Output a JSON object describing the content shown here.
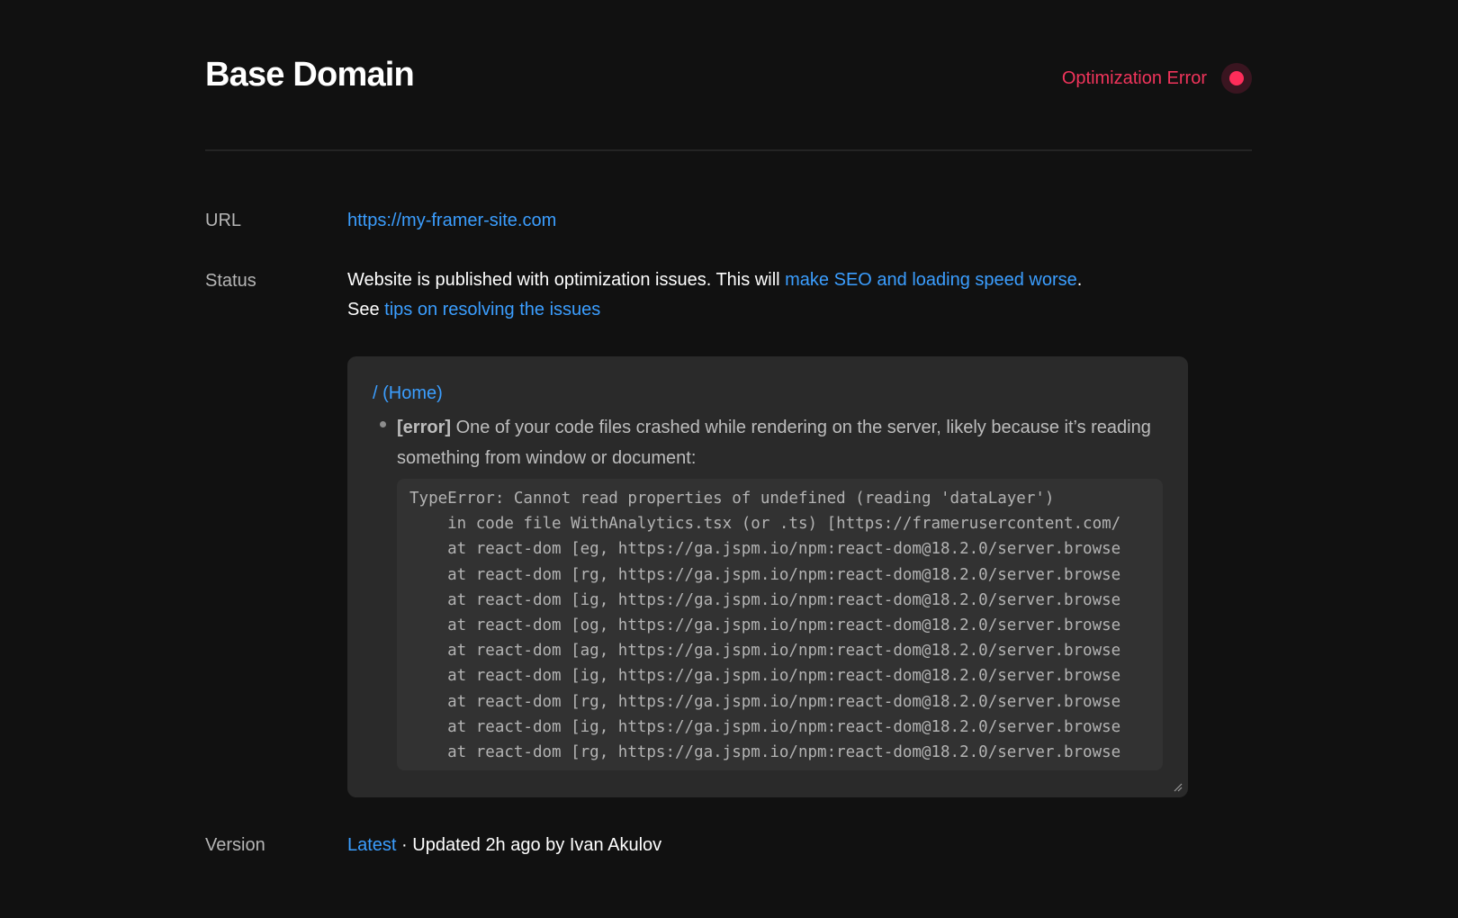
{
  "header": {
    "title": "Base Domain",
    "status_text": "Optimization Error",
    "status_color": "#f0345b"
  },
  "url_row": {
    "label": "URL",
    "value": "https://my-framer-site.com"
  },
  "status_row": {
    "label": "Status",
    "text_before": "Website is published with optimization issues. This will ",
    "link_1": "make SEO and loading speed worse",
    "text_after_link_1": ".",
    "text_see": "See ",
    "link_2": "tips on resolving the issues"
  },
  "error_box": {
    "route": "/ (Home)",
    "error_tag": "[error]",
    "error_message": " One of your code files crashed while rendering on the server, likely because it’s reading something from window or document:",
    "code_lines": [
      "TypeError: Cannot read properties of undefined (reading 'dataLayer')",
      "    in code file WithAnalytics.tsx (or .ts) [https://framerusercontent.com/",
      "    at react-dom [eg, https://ga.jspm.io/npm:react-dom@18.2.0/server.browse",
      "    at react-dom [rg, https://ga.jspm.io/npm:react-dom@18.2.0/server.browse",
      "    at react-dom [ig, https://ga.jspm.io/npm:react-dom@18.2.0/server.browse",
      "    at react-dom [og, https://ga.jspm.io/npm:react-dom@18.2.0/server.browse",
      "    at react-dom [ag, https://ga.jspm.io/npm:react-dom@18.2.0/server.browse",
      "    at react-dom [ig, https://ga.jspm.io/npm:react-dom@18.2.0/server.browse",
      "    at react-dom [rg, https://ga.jspm.io/npm:react-dom@18.2.0/server.browse",
      "    at react-dom [ig, https://ga.jspm.io/npm:react-dom@18.2.0/server.browse",
      "    at react-dom [rg, https://ga.jspm.io/npm:react-dom@18.2.0/server.browse"
    ]
  },
  "version_row": {
    "label": "Version",
    "link": "Latest",
    "separator": " · ",
    "text": "Updated 2h ago by Ivan Akulov"
  },
  "colors": {
    "background": "#111111",
    "link": "#3b9eff",
    "error_dot": "#ff2d5a"
  }
}
